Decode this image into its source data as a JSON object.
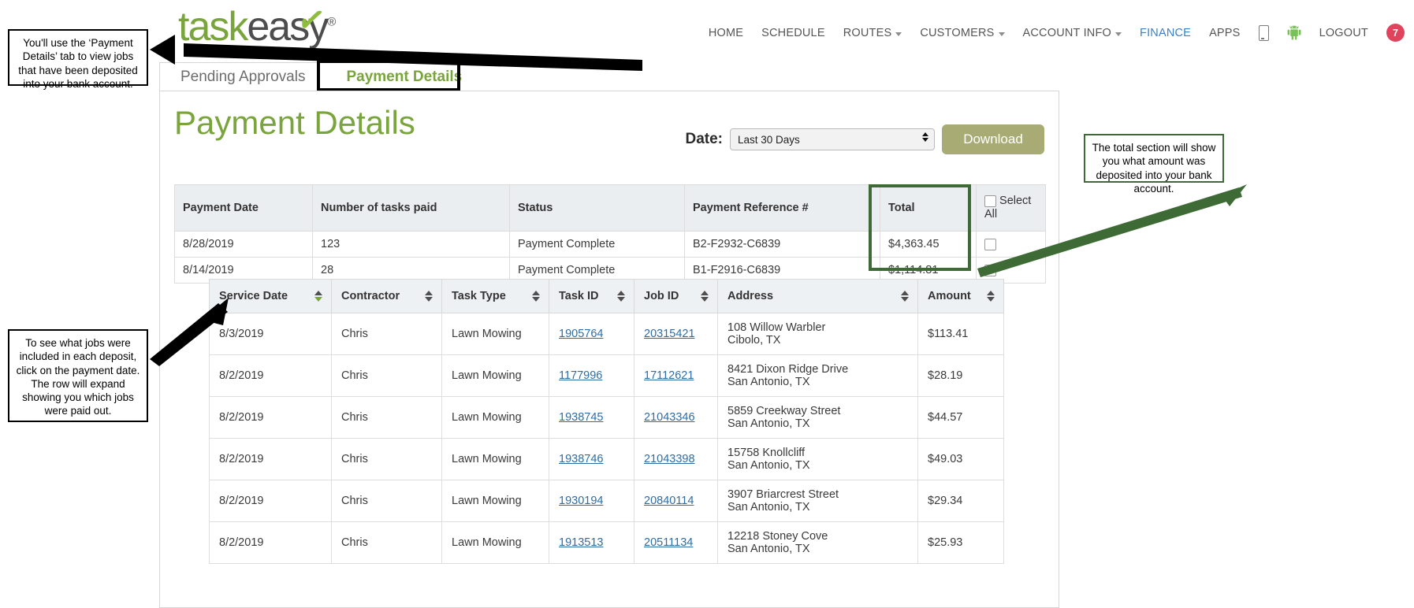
{
  "brand": {
    "logo_task": "task",
    "logo_easy": "eas",
    "logo_y": "y",
    "logo_reg": "®"
  },
  "nav": {
    "items": [
      {
        "label": "HOME",
        "caret": false,
        "active": false
      },
      {
        "label": "SCHEDULE",
        "caret": false,
        "active": false
      },
      {
        "label": "ROUTES",
        "caret": true,
        "active": false
      },
      {
        "label": "CUSTOMERS",
        "caret": true,
        "active": false
      },
      {
        "label": "ACCOUNT INFO",
        "caret": true,
        "active": false
      },
      {
        "label": "FINANCE",
        "caret": false,
        "active": true
      },
      {
        "label": "APPS",
        "caret": false,
        "active": false
      }
    ],
    "phone_icon": "phone-icon",
    "android_icon": "android-icon",
    "logout_label": "LOGOUT",
    "badge_count": "7",
    "badge_color": "#e0435c",
    "active_color": "#3b7fc4"
  },
  "tabs": [
    {
      "label": "Pending Approvals",
      "active": false
    },
    {
      "label": "Payment Details",
      "active": true
    }
  ],
  "page": {
    "title": "Payment Details",
    "title_color": "#7aa43c"
  },
  "toolbar": {
    "date_label": "Date:",
    "date_value": "Last 30 Days",
    "download_label": "Download",
    "download_color": "#a8ab74"
  },
  "payments_table": {
    "columns": [
      "Payment Date",
      "Number of tasks paid",
      "Status",
      "Payment Reference #",
      "Total"
    ],
    "select_all_label": "Select All",
    "rows": [
      {
        "payment_date": "8/28/2019",
        "tasks_paid": "123",
        "status": "Payment Complete",
        "reference": "B2-F2932-C6839",
        "total": "$4,363.45",
        "checked": false
      },
      {
        "payment_date": "8/14/2019",
        "tasks_paid": "28",
        "status": "Payment Complete",
        "reference": "B1-F2916-C6839",
        "total": "$1,114.81",
        "checked": false
      }
    ]
  },
  "jobs_table": {
    "columns": [
      {
        "label": "Service Date",
        "sorted": true
      },
      {
        "label": "Contractor",
        "sorted": false
      },
      {
        "label": "Task Type",
        "sorted": false
      },
      {
        "label": "Task ID",
        "sorted": false
      },
      {
        "label": "Job ID",
        "sorted": false
      },
      {
        "label": "Address",
        "sorted": false
      },
      {
        "label": "Amount",
        "sorted": false
      }
    ],
    "rows": [
      {
        "service_date": "8/3/2019",
        "contractor": "Chris",
        "task_type": "Lawn Mowing",
        "task_id": "1905764",
        "job_id": "20315421",
        "address_line1": "108 Willow Warbler",
        "address_line2": "Cibolo, TX",
        "amount": "$113.41"
      },
      {
        "service_date": "8/2/2019",
        "contractor": "Chris",
        "task_type": "Lawn Mowing",
        "task_id": "1177996",
        "job_id": "17112621",
        "address_line1": "8421 Dixon Ridge Drive",
        "address_line2": "San Antonio, TX",
        "amount": "$28.19"
      },
      {
        "service_date": "8/2/2019",
        "contractor": "Chris",
        "task_type": "Lawn Mowing",
        "task_id": "1938745",
        "job_id": "21043346",
        "address_line1": "5859 Creekway Street",
        "address_line2": "San Antonio, TX",
        "amount": "$44.57"
      },
      {
        "service_date": "8/2/2019",
        "contractor": "Chris",
        "task_type": "Lawn Mowing",
        "task_id": "1938746",
        "job_id": "21043398",
        "address_line1": "15758 Knollcliff",
        "address_line2": "San Antonio, TX",
        "amount": "$49.03"
      },
      {
        "service_date": "8/2/2019",
        "contractor": "Chris",
        "task_type": "Lawn Mowing",
        "task_id": "1930194",
        "job_id": "20840114",
        "address_line1": "3907 Briarcrest Street",
        "address_line2": "San Antonio, TX",
        "amount": "$29.34"
      },
      {
        "service_date": "8/2/2019",
        "contractor": "Chris",
        "task_type": "Lawn Mowing",
        "task_id": "1913513",
        "job_id": "20511134",
        "address_line1": "12218 Stoney Cove",
        "address_line2": "San Antonio, TX",
        "amount": "$25.93"
      }
    ]
  },
  "annotations": {
    "tab_note": "You'll use the ‘Payment Details’ tab to view jobs that have been deposited into your bank account.",
    "expand_note": "To see what jobs were included in each deposit, click on the payment date. The row will expand showing you which jobs were paid out.",
    "total_note": "The total section will show you what amount was deposited into your bank account."
  }
}
